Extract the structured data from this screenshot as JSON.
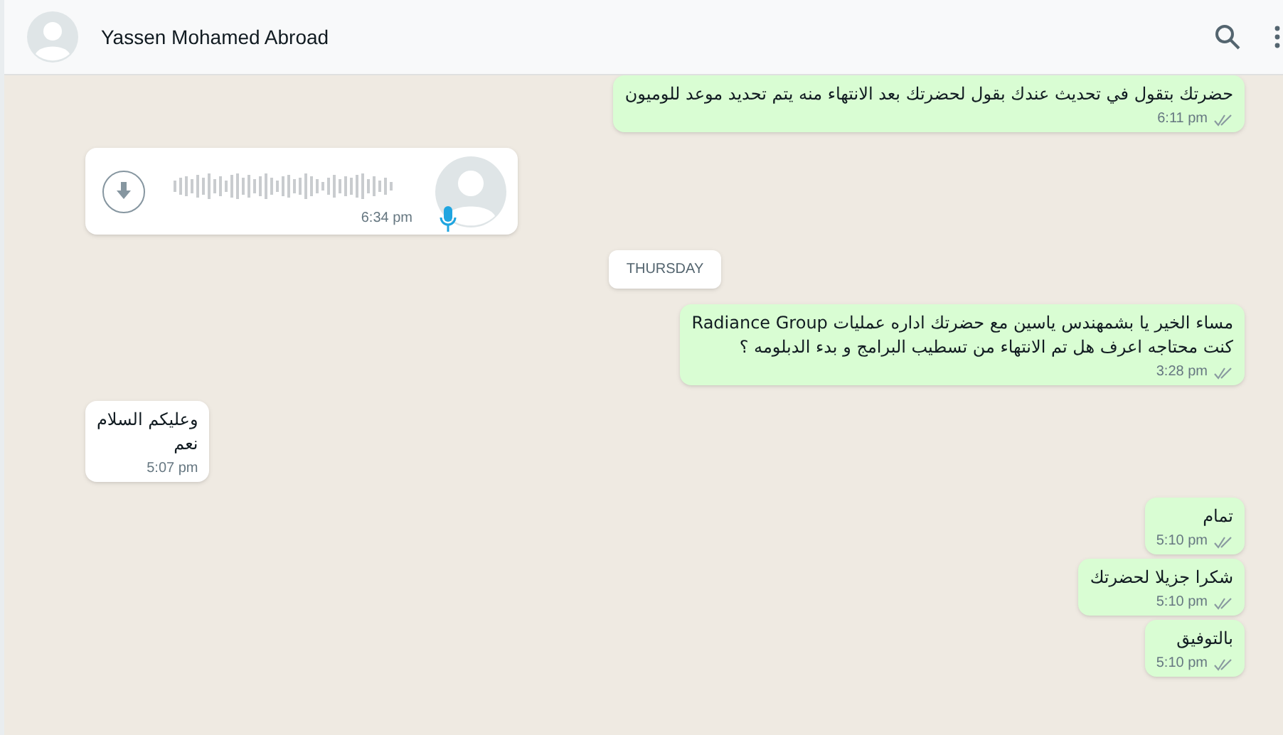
{
  "header": {
    "contact_name": "Yassen Mohamed Abroad"
  },
  "messages": [
    {
      "kind": "text",
      "outgoing": true,
      "text": "حضرتك بتقول في تحديث عندك بقول لحضرتك بعد الانتهاء منه يتم تحديد موعد للوميون",
      "time": "6:11 pm"
    },
    {
      "kind": "voice",
      "outgoing": false,
      "time": "6:34 pm"
    },
    {
      "kind": "date",
      "text": "THURSDAY"
    },
    {
      "kind": "text",
      "outgoing": true,
      "text": "مساء الخير يا بشمهندس ياسين  مع حضرتك اداره عمليات Radiance Group\nكنت محتاجه اعرف هل تم الانتهاء من تسطيب البرامج و بدء الدبلومه  ؟",
      "time": "3:28 pm"
    },
    {
      "kind": "text",
      "outgoing": false,
      "text": "وعليكم السلام\nنعم",
      "time": "5:07 pm"
    },
    {
      "kind": "text",
      "outgoing": true,
      "text": "تمام",
      "time": "5:10 pm"
    },
    {
      "kind": "text",
      "outgoing": true,
      "text": "شكرا جزيلا لحضرتك",
      "time": "5:10 pm"
    },
    {
      "kind": "text",
      "outgoing": true,
      "text": "بالتوفيق",
      "time": "5:10 pm"
    }
  ]
}
